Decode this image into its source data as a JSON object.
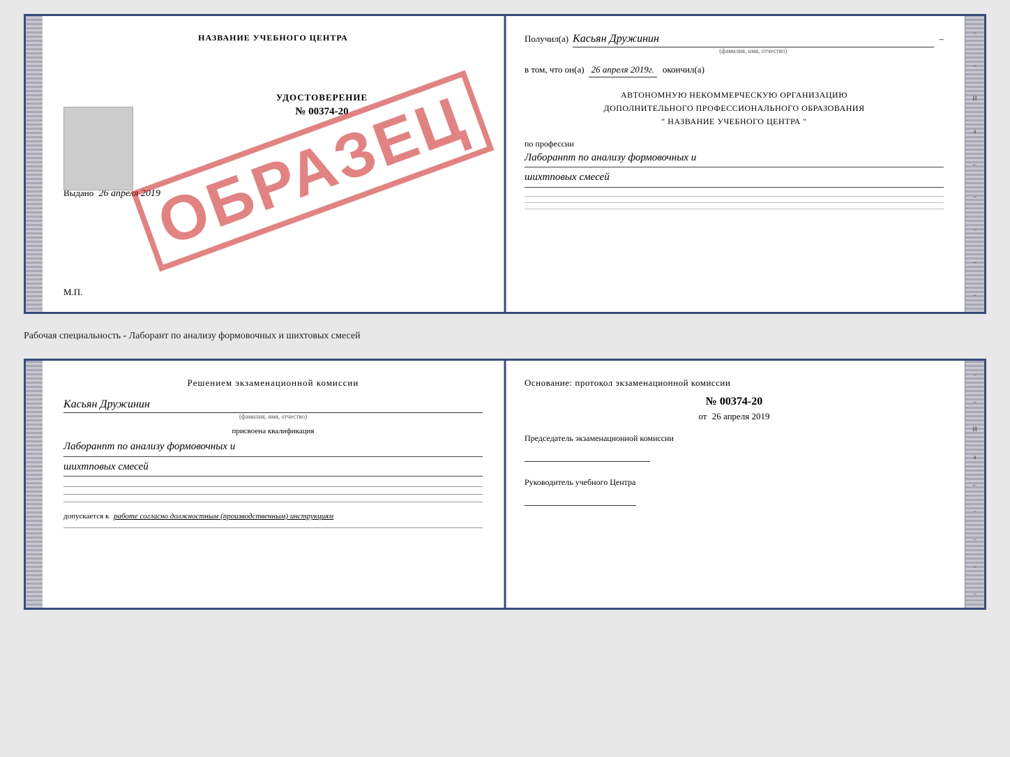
{
  "top_cert": {
    "left": {
      "title": "НАЗВАНИЕ УЧЕБНОГО ЦЕНТРА",
      "udostoverenie": "УДОСТОВЕРЕНИЕ",
      "number": "№ 00374-20",
      "vydano_label": "Выдано",
      "vydano_date": "26 апреля 2019",
      "mp": "М.П.",
      "stamp": "ОБРАЗЕЦ"
    },
    "right": {
      "poluchil_label": "Получил(а)",
      "poluchil_name": "Касьян Дружинин",
      "fio_label": "(фамилия, имя, отчество)",
      "vtom_label": "в том, что он(а)",
      "vtom_date": "26 апреля 2019г.",
      "okonchil_label": "окончил(а)",
      "org_line1": "АВТОНОМНУЮ НЕКОММЕРЧЕСКУЮ ОРГАНИЗАЦИЮ",
      "org_line2": "ДОПОЛНИТЕЛЬНОГО ПРОФЕССИОНАЛЬНОГО ОБРАЗОВАНИЯ",
      "org_quote1": "\"",
      "org_name": "НАЗВАНИЕ УЧЕБНОГО ЦЕНТРА",
      "org_quote2": "\"",
      "po_professii": "по профессии",
      "professiya": "Лаборанпт по анализу формовочных и",
      "professiya2": "шихтповых смесей"
    }
  },
  "specialty_line": "Рабочая специальность - Лаборант по анализу формовочных и шихтовых смесей",
  "bottom_cert": {
    "left": {
      "title": "Решением  экзаменационной  комиссии",
      "name": "Касьян Дружинин",
      "fio_label": "(фамилия, имя, отчество)",
      "prisvoena_label": "присвоена квалификация",
      "kvali": "Лаборанпт по анализу формовочных и",
      "kvali2": "шихтповых смесей",
      "dopusk_label": "допускается к",
      "dopusk_text": "работе согласно должностным (производственным) инструкциям"
    },
    "right": {
      "osnovanie_label": "Основание: протокол экзаменационной  комиссии",
      "number": "№  00374-20",
      "ot_label": "от",
      "ot_date": "26 апреля 2019",
      "predsedatel_label": "Председатель экзаменационной комиссии",
      "rukovoditel_label": "Руководитель учебного Центра"
    }
  },
  "binding": {
    "labels": [
      "И",
      "а",
      "←"
    ]
  }
}
